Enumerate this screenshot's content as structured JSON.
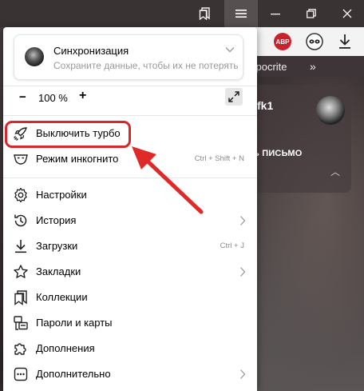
{
  "sync": {
    "title": "Синхронизация",
    "subtitle": "Сохраните данные, чтобы их не потерять"
  },
  "zoom": {
    "minus": "−",
    "value": "100 %",
    "plus": "+"
  },
  "menu_items": [
    {
      "label": "Выключить турбо",
      "icon": "turbo-rocket-icon",
      "shortcut": "",
      "submenu": false
    },
    {
      "label": "Режим инкогнито",
      "icon": "incognito-mask-icon",
      "shortcut": "Ctrl + Shift + N",
      "submenu": false
    },
    {
      "label": "Настройки",
      "icon": "gear-icon",
      "shortcut": "",
      "submenu": false
    },
    {
      "label": "История",
      "icon": "history-clock-icon",
      "shortcut": "",
      "submenu": true
    },
    {
      "label": "Загрузки",
      "icon": "download-icon",
      "shortcut": "Ctrl + J",
      "submenu": false
    },
    {
      "label": "Закладки",
      "icon": "star-icon",
      "shortcut": "",
      "submenu": true
    },
    {
      "label": "Коллекции",
      "icon": "collections-bookmark-icon",
      "shortcut": "",
      "submenu": false
    },
    {
      "label": "Пароли и карты",
      "icon": "key-card-icon",
      "shortcut": "",
      "submenu": false
    },
    {
      "label": "Дополнения",
      "icon": "puzzle-icon",
      "shortcut": "",
      "submenu": false
    },
    {
      "label": "Дополнительно",
      "icon": "more-dots-icon",
      "shortcut": "",
      "submenu": true
    }
  ],
  "toolbar": {
    "abp_label": "ABP"
  },
  "background": {
    "bookmark_text": "ypocrite",
    "bookmark_more": "»",
    "mail_user": "fk1",
    "mail_write": "ь ПИСЬМО"
  },
  "colors": {
    "highlight": "#d8262a",
    "arrow": "#e02a2a",
    "abp_red": "#c8232c"
  }
}
